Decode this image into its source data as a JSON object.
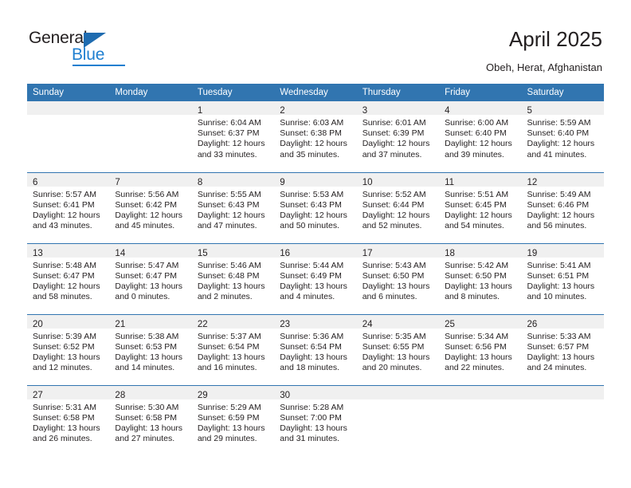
{
  "brand": {
    "name_part1": "General",
    "name_part2": "Blue",
    "accent_color": "#1f7fd0",
    "header_color": "#3175b0"
  },
  "header": {
    "title": "April 2025",
    "location": "Obeh, Herat, Afghanistan"
  },
  "weekday_headers": [
    "Sunday",
    "Monday",
    "Tuesday",
    "Wednesday",
    "Thursday",
    "Friday",
    "Saturday"
  ],
  "weeks": [
    [
      {
        "empty": true
      },
      {
        "empty": true
      },
      {
        "day": "1",
        "sunrise": "Sunrise: 6:04 AM",
        "sunset": "Sunset: 6:37 PM",
        "daylight1": "Daylight: 12 hours",
        "daylight2": "and 33 minutes."
      },
      {
        "day": "2",
        "sunrise": "Sunrise: 6:03 AM",
        "sunset": "Sunset: 6:38 PM",
        "daylight1": "Daylight: 12 hours",
        "daylight2": "and 35 minutes."
      },
      {
        "day": "3",
        "sunrise": "Sunrise: 6:01 AM",
        "sunset": "Sunset: 6:39 PM",
        "daylight1": "Daylight: 12 hours",
        "daylight2": "and 37 minutes."
      },
      {
        "day": "4",
        "sunrise": "Sunrise: 6:00 AM",
        "sunset": "Sunset: 6:40 PM",
        "daylight1": "Daylight: 12 hours",
        "daylight2": "and 39 minutes."
      },
      {
        "day": "5",
        "sunrise": "Sunrise: 5:59 AM",
        "sunset": "Sunset: 6:40 PM",
        "daylight1": "Daylight: 12 hours",
        "daylight2": "and 41 minutes."
      }
    ],
    [
      {
        "day": "6",
        "sunrise": "Sunrise: 5:57 AM",
        "sunset": "Sunset: 6:41 PM",
        "daylight1": "Daylight: 12 hours",
        "daylight2": "and 43 minutes."
      },
      {
        "day": "7",
        "sunrise": "Sunrise: 5:56 AM",
        "sunset": "Sunset: 6:42 PM",
        "daylight1": "Daylight: 12 hours",
        "daylight2": "and 45 minutes."
      },
      {
        "day": "8",
        "sunrise": "Sunrise: 5:55 AM",
        "sunset": "Sunset: 6:43 PM",
        "daylight1": "Daylight: 12 hours",
        "daylight2": "and 47 minutes."
      },
      {
        "day": "9",
        "sunrise": "Sunrise: 5:53 AM",
        "sunset": "Sunset: 6:43 PM",
        "daylight1": "Daylight: 12 hours",
        "daylight2": "and 50 minutes."
      },
      {
        "day": "10",
        "sunrise": "Sunrise: 5:52 AM",
        "sunset": "Sunset: 6:44 PM",
        "daylight1": "Daylight: 12 hours",
        "daylight2": "and 52 minutes."
      },
      {
        "day": "11",
        "sunrise": "Sunrise: 5:51 AM",
        "sunset": "Sunset: 6:45 PM",
        "daylight1": "Daylight: 12 hours",
        "daylight2": "and 54 minutes."
      },
      {
        "day": "12",
        "sunrise": "Sunrise: 5:49 AM",
        "sunset": "Sunset: 6:46 PM",
        "daylight1": "Daylight: 12 hours",
        "daylight2": "and 56 minutes."
      }
    ],
    [
      {
        "day": "13",
        "sunrise": "Sunrise: 5:48 AM",
        "sunset": "Sunset: 6:47 PM",
        "daylight1": "Daylight: 12 hours",
        "daylight2": "and 58 minutes."
      },
      {
        "day": "14",
        "sunrise": "Sunrise: 5:47 AM",
        "sunset": "Sunset: 6:47 PM",
        "daylight1": "Daylight: 13 hours",
        "daylight2": "and 0 minutes."
      },
      {
        "day": "15",
        "sunrise": "Sunrise: 5:46 AM",
        "sunset": "Sunset: 6:48 PM",
        "daylight1": "Daylight: 13 hours",
        "daylight2": "and 2 minutes."
      },
      {
        "day": "16",
        "sunrise": "Sunrise: 5:44 AM",
        "sunset": "Sunset: 6:49 PM",
        "daylight1": "Daylight: 13 hours",
        "daylight2": "and 4 minutes."
      },
      {
        "day": "17",
        "sunrise": "Sunrise: 5:43 AM",
        "sunset": "Sunset: 6:50 PM",
        "daylight1": "Daylight: 13 hours",
        "daylight2": "and 6 minutes."
      },
      {
        "day": "18",
        "sunrise": "Sunrise: 5:42 AM",
        "sunset": "Sunset: 6:50 PM",
        "daylight1": "Daylight: 13 hours",
        "daylight2": "and 8 minutes."
      },
      {
        "day": "19",
        "sunrise": "Sunrise: 5:41 AM",
        "sunset": "Sunset: 6:51 PM",
        "daylight1": "Daylight: 13 hours",
        "daylight2": "and 10 minutes."
      }
    ],
    [
      {
        "day": "20",
        "sunrise": "Sunrise: 5:39 AM",
        "sunset": "Sunset: 6:52 PM",
        "daylight1": "Daylight: 13 hours",
        "daylight2": "and 12 minutes."
      },
      {
        "day": "21",
        "sunrise": "Sunrise: 5:38 AM",
        "sunset": "Sunset: 6:53 PM",
        "daylight1": "Daylight: 13 hours",
        "daylight2": "and 14 minutes."
      },
      {
        "day": "22",
        "sunrise": "Sunrise: 5:37 AM",
        "sunset": "Sunset: 6:54 PM",
        "daylight1": "Daylight: 13 hours",
        "daylight2": "and 16 minutes."
      },
      {
        "day": "23",
        "sunrise": "Sunrise: 5:36 AM",
        "sunset": "Sunset: 6:54 PM",
        "daylight1": "Daylight: 13 hours",
        "daylight2": "and 18 minutes."
      },
      {
        "day": "24",
        "sunrise": "Sunrise: 5:35 AM",
        "sunset": "Sunset: 6:55 PM",
        "daylight1": "Daylight: 13 hours",
        "daylight2": "and 20 minutes."
      },
      {
        "day": "25",
        "sunrise": "Sunrise: 5:34 AM",
        "sunset": "Sunset: 6:56 PM",
        "daylight1": "Daylight: 13 hours",
        "daylight2": "and 22 minutes."
      },
      {
        "day": "26",
        "sunrise": "Sunrise: 5:33 AM",
        "sunset": "Sunset: 6:57 PM",
        "daylight1": "Daylight: 13 hours",
        "daylight2": "and 24 minutes."
      }
    ],
    [
      {
        "day": "27",
        "sunrise": "Sunrise: 5:31 AM",
        "sunset": "Sunset: 6:58 PM",
        "daylight1": "Daylight: 13 hours",
        "daylight2": "and 26 minutes."
      },
      {
        "day": "28",
        "sunrise": "Sunrise: 5:30 AM",
        "sunset": "Sunset: 6:58 PM",
        "daylight1": "Daylight: 13 hours",
        "daylight2": "and 27 minutes."
      },
      {
        "day": "29",
        "sunrise": "Sunrise: 5:29 AM",
        "sunset": "Sunset: 6:59 PM",
        "daylight1": "Daylight: 13 hours",
        "daylight2": "and 29 minutes."
      },
      {
        "day": "30",
        "sunrise": "Sunrise: 5:28 AM",
        "sunset": "Sunset: 7:00 PM",
        "daylight1": "Daylight: 13 hours",
        "daylight2": "and 31 minutes."
      },
      {
        "empty": true
      },
      {
        "empty": true
      },
      {
        "empty": true
      }
    ]
  ]
}
